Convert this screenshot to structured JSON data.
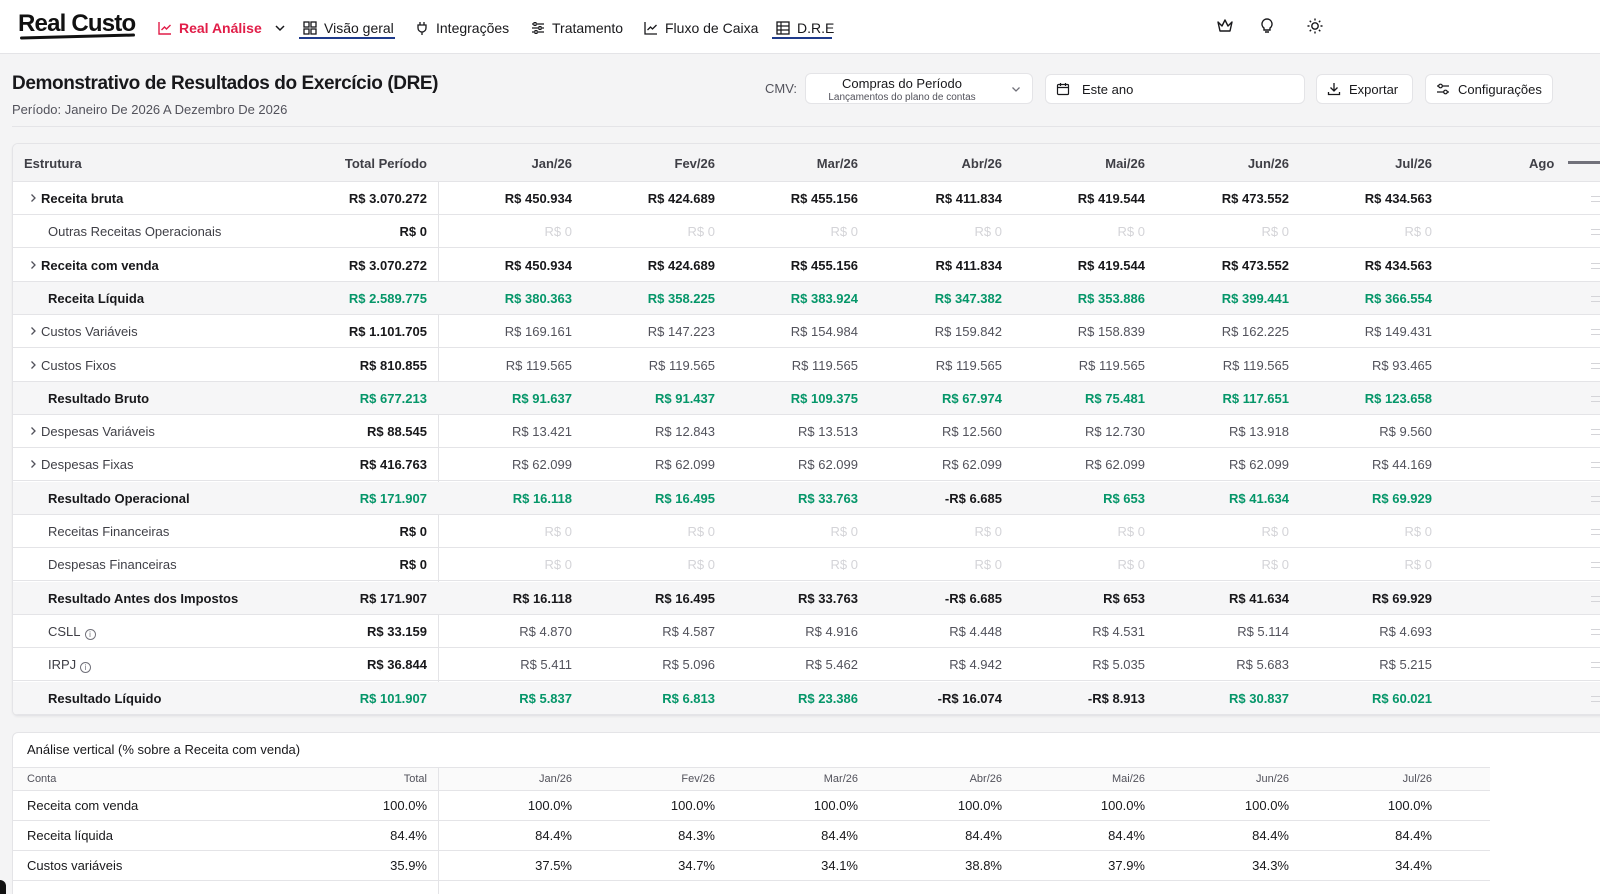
{
  "brand": {
    "name": "Real Custo"
  },
  "nav": {
    "items": [
      {
        "label": "Real Análise",
        "icon": "line-chart-icon"
      },
      {
        "label": "Visão geral",
        "icon": "grid-icon"
      },
      {
        "label": "Integrações",
        "icon": "plug-icon"
      },
      {
        "label": "Tratamento",
        "icon": "sliders-icon"
      },
      {
        "label": "Fluxo de Caixa",
        "icon": "line-chart-icon"
      },
      {
        "label": "D.R.E",
        "icon": "table-icon"
      }
    ],
    "right_icons": [
      "crown-icon",
      "lightbulb-icon",
      "sun-icon"
    ]
  },
  "header": {
    "title": "Demonstrativo de Resultados do Exercício (DRE)",
    "subtitle": "Período: Janeiro De 2026 A Dezembro De 2026",
    "cmv_label": "CMV:",
    "cmv_value": "Compras do Período",
    "cmv_sub": "Lançamentos do plano de contas",
    "date_value": "Este ano",
    "export_label": "Exportar",
    "settings_label": "Configurações"
  },
  "dre": {
    "columns": [
      "Estrutura",
      "Total Período",
      "Jan/26",
      "Fev/26",
      "Mar/26",
      "Abr/26",
      "Mai/26",
      "Jun/26",
      "Jul/26",
      "Ago"
    ],
    "rows": [
      {
        "label": "Receita bruta",
        "style": "strong",
        "expandable": true,
        "total": "R$ 3.070.272",
        "values": [
          "R$ 450.934",
          "R$ 424.689",
          "R$ 455.156",
          "R$ 411.834",
          "R$ 419.544",
          "R$ 473.552",
          "R$ 434.563"
        ]
      },
      {
        "label": "Outras Receitas Operacionais",
        "style": "muted",
        "expandable": false,
        "total": "R$ 0",
        "values": [
          "R$ 0",
          "R$ 0",
          "R$ 0",
          "R$ 0",
          "R$ 0",
          "R$ 0",
          "R$ 0"
        ]
      },
      {
        "label": "Receita com venda",
        "style": "strong",
        "expandable": true,
        "total": "R$ 3.070.272",
        "values": [
          "R$ 450.934",
          "R$ 424.689",
          "R$ 455.156",
          "R$ 411.834",
          "R$ 419.544",
          "R$ 473.552",
          "R$ 434.563"
        ]
      },
      {
        "label": "Receita Líquida",
        "style": "green",
        "expandable": false,
        "total": "R$ 2.589.775",
        "values": [
          "R$ 380.363",
          "R$ 358.225",
          "R$ 383.924",
          "R$ 347.382",
          "R$ 353.886",
          "R$ 399.441",
          "R$ 366.554"
        ]
      },
      {
        "label": "Custos Variáveis",
        "style": "normal",
        "expandable": true,
        "total": "R$ 1.101.705",
        "values": [
          "R$ 169.161",
          "R$ 147.223",
          "R$ 154.984",
          "R$ 159.842",
          "R$ 158.839",
          "R$ 162.225",
          "R$ 149.431"
        ]
      },
      {
        "label": "Custos Fixos",
        "style": "normal",
        "expandable": true,
        "total": "R$ 810.855",
        "values": [
          "R$ 119.565",
          "R$ 119.565",
          "R$ 119.565",
          "R$ 119.565",
          "R$ 119.565",
          "R$ 119.565",
          "R$ 93.465"
        ]
      },
      {
        "label": "Resultado Bruto",
        "style": "green",
        "expandable": false,
        "total": "R$ 677.213",
        "values": [
          "R$ 91.637",
          "R$ 91.437",
          "R$ 109.375",
          "R$ 67.974",
          "R$ 75.481",
          "R$ 117.651",
          "R$ 123.658"
        ]
      },
      {
        "label": "Despesas Variáveis",
        "style": "normal",
        "expandable": true,
        "total": "R$ 88.545",
        "values": [
          "R$ 13.421",
          "R$ 12.843",
          "R$ 13.513",
          "R$ 12.560",
          "R$ 12.730",
          "R$ 13.918",
          "R$ 9.560"
        ]
      },
      {
        "label": "Despesas Fixas",
        "style": "normal",
        "expandable": true,
        "total": "R$ 416.763",
        "values": [
          "R$ 62.099",
          "R$ 62.099",
          "R$ 62.099",
          "R$ 62.099",
          "R$ 62.099",
          "R$ 62.099",
          "R$ 44.169"
        ]
      },
      {
        "label": "Resultado Operacional",
        "style": "green",
        "expandable": false,
        "total": "R$ 171.907",
        "values": [
          "R$ 16.118",
          "R$ 16.495",
          "R$ 33.763",
          "-R$ 6.685",
          "R$ 653",
          "R$ 41.634",
          "R$ 69.929"
        ]
      },
      {
        "label": "Receitas Financeiras",
        "style": "muted",
        "expandable": false,
        "total": "R$ 0",
        "values": [
          "R$ 0",
          "R$ 0",
          "R$ 0",
          "R$ 0",
          "R$ 0",
          "R$ 0",
          "R$ 0"
        ]
      },
      {
        "label": "Despesas Financeiras",
        "style": "muted",
        "expandable": false,
        "total": "R$ 0",
        "values": [
          "R$ 0",
          "R$ 0",
          "R$ 0",
          "R$ 0",
          "R$ 0",
          "R$ 0",
          "R$ 0"
        ]
      },
      {
        "label": "Resultado Antes dos Impostos",
        "style": "black",
        "expandable": false,
        "total": "R$ 171.907",
        "values": [
          "R$ 16.118",
          "R$ 16.495",
          "R$ 33.763",
          "-R$ 6.685",
          "R$ 653",
          "R$ 41.634",
          "R$ 69.929"
        ]
      },
      {
        "label": "CSLL",
        "style": "info",
        "expandable": false,
        "total": "R$ 33.159",
        "values": [
          "R$ 4.870",
          "R$ 4.587",
          "R$ 4.916",
          "R$ 4.448",
          "R$ 4.531",
          "R$ 5.114",
          "R$ 4.693"
        ]
      },
      {
        "label": "IRPJ",
        "style": "info",
        "expandable": false,
        "total": "R$ 36.844",
        "values": [
          "R$ 5.411",
          "R$ 5.096",
          "R$ 5.462",
          "R$ 4.942",
          "R$ 5.035",
          "R$ 5.683",
          "R$ 5.215"
        ]
      },
      {
        "label": "Resultado Líquido",
        "style": "green",
        "expandable": false,
        "total": "R$ 101.907",
        "values": [
          "R$ 5.837",
          "R$ 6.813",
          "R$ 23.386",
          "-R$ 16.074",
          "-R$ 8.913",
          "R$ 30.837",
          "R$ 60.021"
        ]
      }
    ]
  },
  "vertical_analysis": {
    "title": "Análise vertical (% sobre a Receita com venda)",
    "columns": [
      "Conta",
      "Total",
      "Jan/26",
      "Fev/26",
      "Mar/26",
      "Abr/26",
      "Mai/26",
      "Jun/26",
      "Jul/26"
    ],
    "rows": [
      {
        "label": "Receita com venda",
        "total": "100.0%",
        "values": [
          "100.0%",
          "100.0%",
          "100.0%",
          "100.0%",
          "100.0%",
          "100.0%",
          "100.0%"
        ]
      },
      {
        "label": "Receita líquida",
        "total": "84.4%",
        "values": [
          "84.4%",
          "84.3%",
          "84.4%",
          "84.4%",
          "84.4%",
          "84.4%",
          "84.4%"
        ]
      },
      {
        "label": "Custos variáveis",
        "total": "35.9%",
        "values": [
          "37.5%",
          "34.7%",
          "34.1%",
          "38.8%",
          "37.9%",
          "34.3%",
          "34.4%"
        ]
      }
    ]
  },
  "colors": {
    "brand": "#e11d48",
    "positive": "#059669",
    "nav_underline": "#1e3a8a"
  }
}
